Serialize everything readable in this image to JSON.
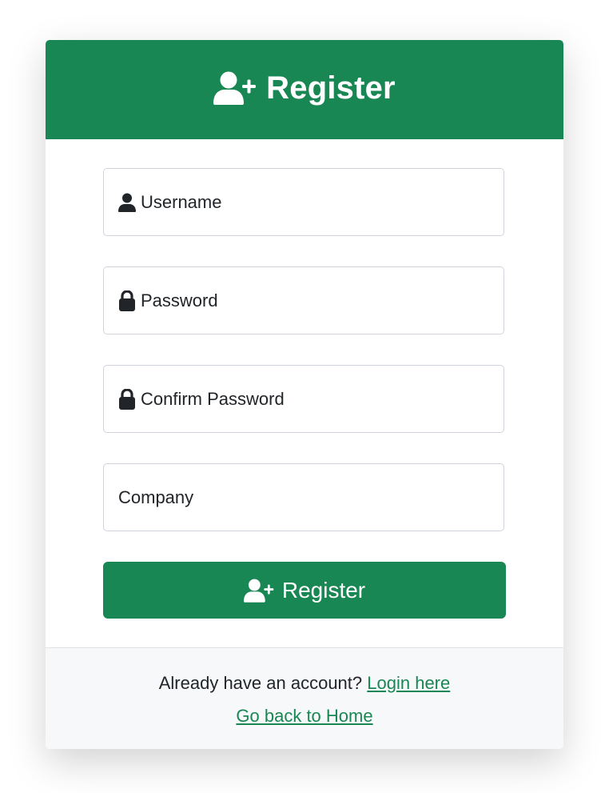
{
  "header": {
    "title": "Register",
    "icon": "user-plus-icon"
  },
  "form": {
    "username": {
      "placeholder": "Username",
      "icon": "user-icon"
    },
    "password": {
      "placeholder": "Password",
      "icon": "lock-icon"
    },
    "confirm_password": {
      "placeholder": "Confirm Password",
      "icon": "lock-icon"
    },
    "company": {
      "placeholder": "Company"
    },
    "submit_label": "Register",
    "submit_icon": "user-plus-icon"
  },
  "footer": {
    "prompt": "Already have an account?",
    "login_link": "Login here",
    "home_link": "Go back to Home"
  },
  "colors": {
    "primary": "#198754",
    "footer_bg": "#f7f8f9",
    "text": "#212529"
  }
}
